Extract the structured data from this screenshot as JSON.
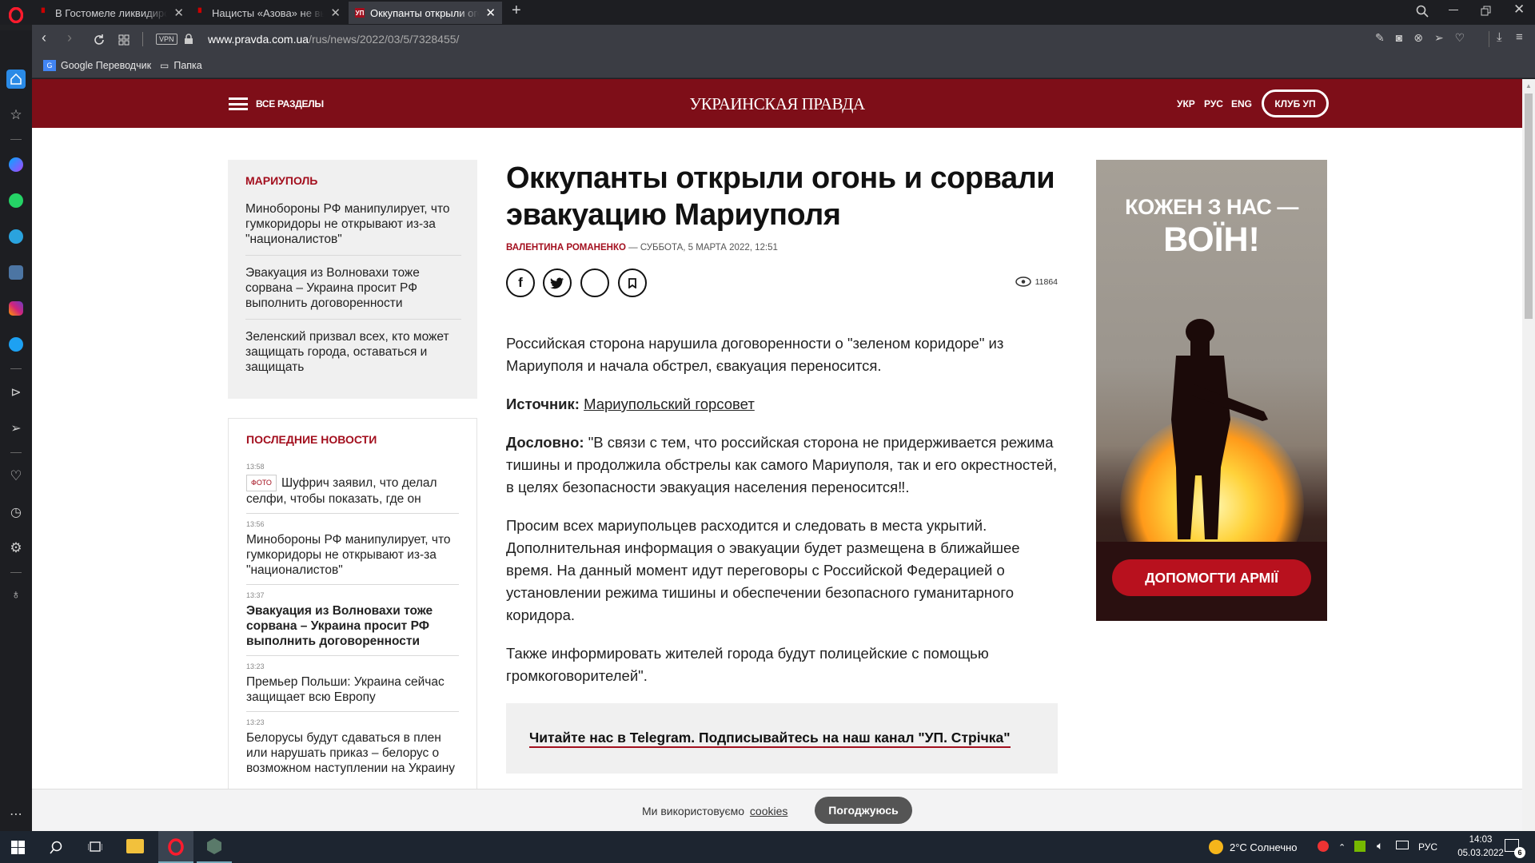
{
  "browser": {
    "tabs": [
      {
        "title": "В Гостомеле ликвидирова"
      },
      {
        "title": "Нацисты «Азова» не выпу"
      },
      {
        "title": "Оккупанты открыли огонь",
        "favicon": "УП"
      }
    ],
    "new_tab": "+",
    "vpn": "VPN",
    "url_host": "www.pravda.com.ua",
    "url_path": "/rus/news/2022/03/5/7328455/",
    "bookmarks": [
      {
        "label": "Google Переводчик"
      },
      {
        "label": "Папка"
      }
    ]
  },
  "site": {
    "sections_label": "ВСЕ РАЗДЕЛЫ",
    "logo": "УКРАИНСКАЯ ПРАВДА",
    "langs": [
      "УКР",
      "РУС",
      "ENG"
    ],
    "club_button": "КЛУБ УП",
    "brand_color": "#7e0e18"
  },
  "left": {
    "topic_title": "МАРИУПОЛЬ",
    "topic_items": [
      "Минобороны РФ манипулирует, что гумкоридоры не открывают из-за \"националистов\"",
      "Эвакуация из Волновахи тоже сорвана – Украина просит РФ выполнить договоренности",
      "Зеленский призвал всех, кто может защищать города, оставаться и защищать"
    ],
    "latest_title": "ПОСЛЕДНИЕ НОВОСТИ",
    "latest": [
      {
        "time": "13:58",
        "badge": "ФОТО",
        "text": "Шуфрич заявил, что делал селфи, чтобы показать, где он",
        "bold": false
      },
      {
        "time": "13:56",
        "badge": "",
        "text": "Минобороны РФ манипулирует, что гумкоридоры не открывают из-за \"националистов\"",
        "bold": false
      },
      {
        "time": "13:37",
        "badge": "",
        "text": "Эвакуация из Волновахи тоже сорвана – Украина просит РФ выполнить договоренности",
        "bold": true
      },
      {
        "time": "13:23",
        "badge": "",
        "text": "Премьер Польши: Украина сейчас защищает всю Европу",
        "bold": false
      },
      {
        "time": "13:23",
        "badge": "",
        "text": "Белорусы будут сдаваться в плен или нарушать приказ – белорус о возможном наступлении на Украину",
        "bold": false
      }
    ]
  },
  "article": {
    "title": "Оккупанты открыли огонь и сорвали эвакуацию Мариуполя",
    "author": "ВАЛЕНТИНА РОМАНЕНКО",
    "date": "— СУББОТА, 5 МАРТА 2022, 12:51",
    "views": "11864",
    "lead": "Российская сторона нарушила договоренности о \"зеленом коридоре\" из Мариуполя и начала обстрел, євакуация переносится.",
    "source_label": "Источник:",
    "source_link": "Мариупольский горсовет",
    "quote_label": "Дословно:",
    "quote_text": "\"В связи с тем, что российская сторона не придерживается режима тишины и продолжила обстрелы как самого Мариуполя, так и его окрестностей, в целях безопасности эвакуация населения переносится‼.",
    "para3": "Просим всех мариупольцев расходится и следовать в места укрытий. Дополнительная информация о эвакуации будет размещена в ближайшее время. На данный момент идут переговоры с Российской Федерацией о установлении режима тишины и обеспечении безопасного гуманитарного коридора.",
    "para4": "Также информировать жителей города будут полицейские с помощью громкоговорителей\".",
    "telegram": "Читайте нас в Telegram. Подписывайтесь на наш канал \"УП. Стрічка\""
  },
  "ad": {
    "line1": "КОЖЕН З НАС —",
    "line2": "ВОЇН!",
    "button": "ДОПОМОГТИ АРМІЇ"
  },
  "cookie": {
    "text": "Ми використовуємо",
    "link": "cookies",
    "button": "Погоджуюсь"
  },
  "taskbar": {
    "weather": "2°C  Солнечно",
    "lang": "РУС",
    "time": "14:03",
    "date": "05.03.2022",
    "notif_count": "6"
  }
}
